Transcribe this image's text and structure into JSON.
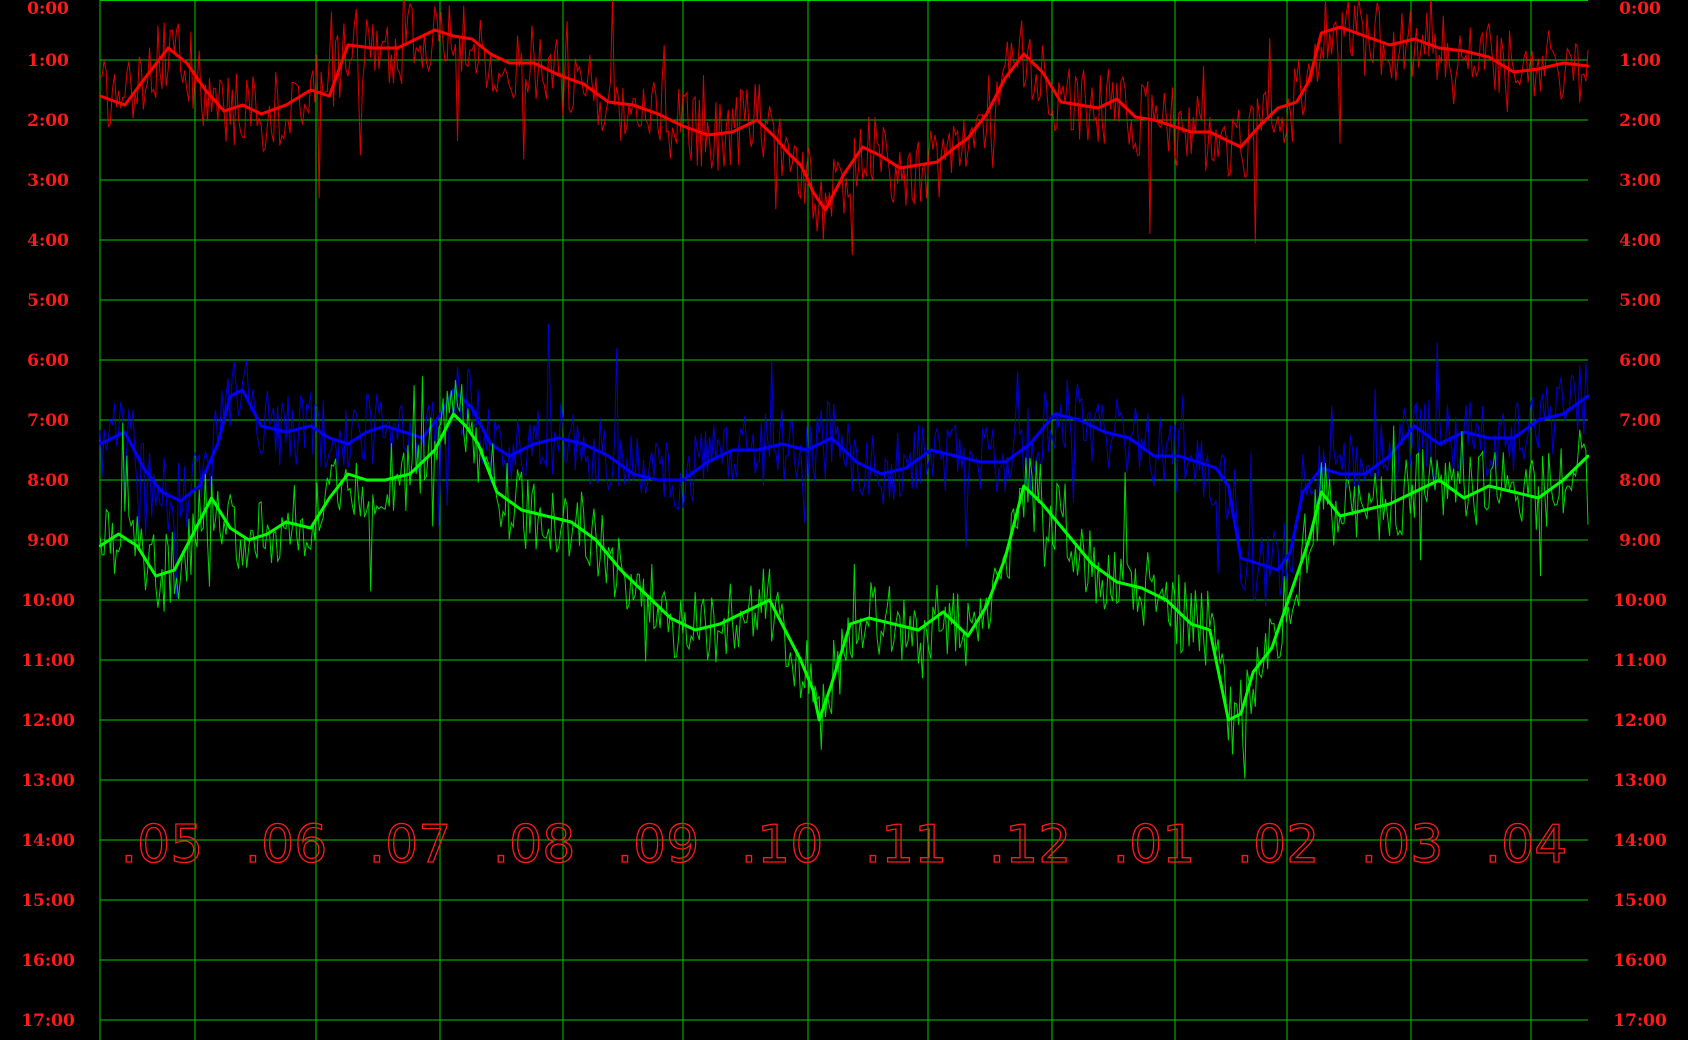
{
  "chart_data": {
    "type": "line",
    "y_axis": {
      "ticks": [
        "0:00",
        "1:00",
        "2:00",
        "3:00",
        "4:00",
        "5:00",
        "6:00",
        "7:00",
        "8:00",
        "9:00",
        "10:00",
        "11:00",
        "12:00",
        "13:00",
        "14:00",
        "15:00",
        "16:00",
        "17:00"
      ],
      "range": [
        0,
        17
      ],
      "inverted": true,
      "labels_on_both_sides": true
    },
    "x_axis": {
      "month_labels": [
        ".05",
        ".06",
        ".07",
        ".08",
        ".09",
        ".10",
        ".11",
        ".12",
        ".01",
        ".02",
        ".03",
        ".04"
      ],
      "range": [
        0,
        12
      ]
    },
    "grid": true,
    "colors": {
      "background": "#000000",
      "grid": "#00c800",
      "labels": "#ff1a1a",
      "red_series": "#ff0000",
      "blue_series": "#0000ff",
      "green_series": "#00ff00"
    },
    "series": [
      {
        "color": "#ff0000",
        "x": [
          0,
          0.2,
          0.4,
          0.55,
          0.7,
          0.85,
          1,
          1.15,
          1.3,
          1.5,
          1.7,
          1.85,
          2,
          2.2,
          2.4,
          2.55,
          2.7,
          2.85,
          3,
          3.15,
          3.3,
          3.5,
          3.7,
          3.9,
          4.1,
          4.3,
          4.5,
          4.7,
          4.9,
          5.1,
          5.3,
          5.45,
          5.55,
          5.65,
          5.7,
          5.75,
          5.85,
          6,
          6.15,
          6.3,
          6.45,
          6.6,
          6.75,
          6.9,
          7,
          7.15,
          7.3,
          7.45,
          7.6,
          7.75,
          7.9,
          8.05,
          8.2,
          8.35,
          8.5,
          8.65,
          8.8,
          8.95,
          9.1,
          9.2,
          9.35,
          9.5,
          9.65,
          9.75,
          9.85,
          10,
          10.2,
          10.4,
          10.6,
          10.8,
          11,
          11.2,
          11.4,
          11.6,
          11.8,
          12
        ],
        "values": [
          1.6,
          1.75,
          1.2,
          0.8,
          1.05,
          1.5,
          1.85,
          1.75,
          1.9,
          1.75,
          1.5,
          1.6,
          0.75,
          0.8,
          0.8,
          0.65,
          0.5,
          0.6,
          0.65,
          0.9,
          1.05,
          1.05,
          1.25,
          1.4,
          1.7,
          1.75,
          1.9,
          2.1,
          2.25,
          2.2,
          2.0,
          2.3,
          2.55,
          2.75,
          2.95,
          3.2,
          3.5,
          2.9,
          2.45,
          2.6,
          2.8,
          2.75,
          2.7,
          2.45,
          2.3,
          1.9,
          1.3,
          0.9,
          1.2,
          1.7,
          1.75,
          1.8,
          1.65,
          1.95,
          2.0,
          2.1,
          2.2,
          2.2,
          2.35,
          2.45,
          2.1,
          1.8,
          1.7,
          1.35,
          0.55,
          0.45,
          0.6,
          0.75,
          0.65,
          0.8,
          0.85,
          0.95,
          1.2,
          1.15,
          1.05,
          1.1
        ]
      },
      {
        "color": "#0000ff",
        "x": [
          0,
          0.2,
          0.35,
          0.5,
          0.65,
          0.8,
          0.95,
          1.05,
          1.15,
          1.3,
          1.5,
          1.7,
          1.85,
          2,
          2.15,
          2.3,
          2.45,
          2.6,
          2.75,
          2.85,
          3,
          3.15,
          3.3,
          3.5,
          3.7,
          3.9,
          4.1,
          4.3,
          4.5,
          4.7,
          4.9,
          5.1,
          5.3,
          5.5,
          5.7,
          5.9,
          6.1,
          6.3,
          6.5,
          6.7,
          6.9,
          7.1,
          7.3,
          7.5,
          7.7,
          7.9,
          8.1,
          8.3,
          8.5,
          8.7,
          8.85,
          9,
          9.1,
          9.2,
          9.35,
          9.5,
          9.6,
          9.7,
          9.85,
          10,
          10.2,
          10.4,
          10.6,
          10.8,
          11,
          11.2,
          11.4,
          11.6,
          11.8,
          12
        ],
        "values": [
          7.4,
          7.2,
          7.8,
          8.2,
          8.35,
          8.1,
          7.4,
          6.6,
          6.5,
          7.1,
          7.2,
          7.1,
          7.3,
          7.4,
          7.2,
          7.1,
          7.2,
          7.3,
          6.9,
          6.5,
          6.8,
          7.4,
          7.6,
          7.4,
          7.3,
          7.4,
          7.6,
          7.9,
          8.0,
          8.0,
          7.7,
          7.5,
          7.5,
          7.4,
          7.5,
          7.3,
          7.7,
          7.9,
          7.8,
          7.5,
          7.6,
          7.7,
          7.7,
          7.4,
          6.9,
          7.0,
          7.2,
          7.3,
          7.6,
          7.6,
          7.7,
          7.8,
          8.1,
          9.3,
          9.4,
          9.5,
          9.2,
          8.2,
          7.8,
          7.9,
          7.9,
          7.6,
          7.1,
          7.4,
          7.2,
          7.3,
          7.3,
          7.0,
          6.9,
          6.6
        ]
      },
      {
        "color": "#00ff00",
        "x": [
          0,
          0.15,
          0.3,
          0.45,
          0.6,
          0.75,
          0.9,
          1.05,
          1.2,
          1.35,
          1.5,
          1.7,
          1.85,
          2,
          2.15,
          2.3,
          2.5,
          2.7,
          2.85,
          2.95,
          3.05,
          3.2,
          3.4,
          3.6,
          3.8,
          4.0,
          4.2,
          4.4,
          4.6,
          4.8,
          5.0,
          5.2,
          5.4,
          5.55,
          5.65,
          5.75,
          5.8,
          5.9,
          6.05,
          6.2,
          6.4,
          6.6,
          6.8,
          7.0,
          7.15,
          7.3,
          7.45,
          7.6,
          7.8,
          8.0,
          8.2,
          8.4,
          8.6,
          8.8,
          8.95,
          9.05,
          9.1,
          9.2,
          9.3,
          9.45,
          9.6,
          9.75,
          9.85,
          10.0,
          10.2,
          10.4,
          10.6,
          10.8,
          11.0,
          11.2,
          11.4,
          11.6,
          11.8,
          12
        ],
        "values": [
          9.1,
          8.9,
          9.1,
          9.6,
          9.5,
          8.9,
          8.3,
          8.8,
          9.0,
          8.9,
          8.7,
          8.8,
          8.3,
          7.9,
          8.0,
          8.0,
          7.9,
          7.5,
          6.9,
          7.1,
          7.4,
          8.2,
          8.5,
          8.6,
          8.7,
          9.0,
          9.5,
          9.9,
          10.3,
          10.5,
          10.4,
          10.2,
          10.0,
          10.6,
          11.0,
          11.5,
          12.0,
          11.4,
          10.4,
          10.3,
          10.4,
          10.5,
          10.2,
          10.6,
          10.1,
          9.3,
          8.1,
          8.4,
          8.9,
          9.4,
          9.7,
          9.8,
          10.0,
          10.4,
          10.5,
          11.5,
          12.0,
          11.9,
          11.2,
          10.8,
          9.9,
          9.0,
          8.2,
          8.6,
          8.5,
          8.4,
          8.2,
          8.0,
          8.3,
          8.1,
          8.2,
          8.3,
          8.0,
          7.6
        ]
      }
    ]
  }
}
